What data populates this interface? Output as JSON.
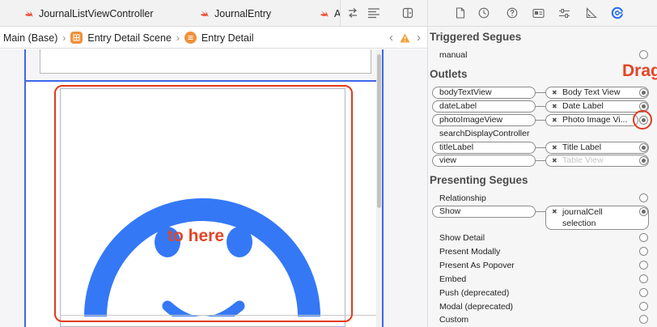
{
  "tabs": [
    {
      "label": "JournalListViewController"
    },
    {
      "label": "JournalEntry"
    },
    {
      "label": "A"
    }
  ],
  "breadcrumb": {
    "items": [
      "Main (Base)",
      "Entry Detail Scene",
      "Entry Detail"
    ]
  },
  "canvas": {
    "annotation": "to here",
    "accent_color": "#3478f6",
    "highlight_color": "#e03a1b"
  },
  "inspector": {
    "annotation": "Drag",
    "triggered_segues": {
      "title": "Triggered Segues",
      "rows": [
        {
          "label": "manual"
        }
      ]
    },
    "outlets": {
      "title": "Outlets",
      "rows": [
        {
          "name": "bodyTextView",
          "target": "Body Text View"
        },
        {
          "name": "dateLabel",
          "target": "Date Label"
        },
        {
          "name": "photoImageView",
          "target": "Photo Image Vi..."
        },
        {
          "name": "searchDisplayController",
          "target": ""
        },
        {
          "name": "titleLabel",
          "target": "Title Label"
        },
        {
          "name": "view",
          "target": "Table View"
        }
      ]
    },
    "presenting_segues": {
      "title": "Presenting Segues",
      "rows": [
        {
          "label": "Relationship"
        },
        {
          "label": "Show",
          "target_line1": "journalCell",
          "target_line2": "selection"
        },
        {
          "label": "Show Detail"
        },
        {
          "label": "Present Modally"
        },
        {
          "label": "Present As Popover"
        },
        {
          "label": "Embed"
        },
        {
          "label": "Push (deprecated)"
        },
        {
          "label": "Modal (deprecated)"
        },
        {
          "label": "Custom"
        }
      ]
    }
  }
}
